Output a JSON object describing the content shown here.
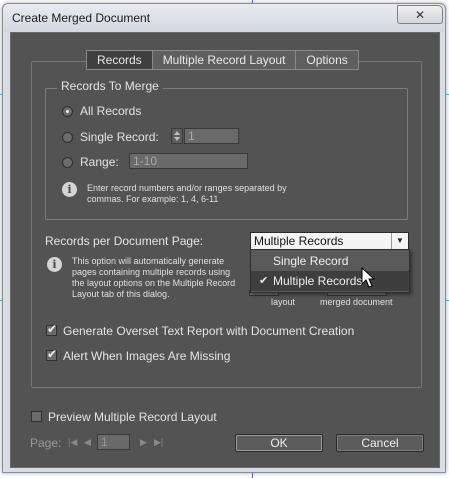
{
  "window": {
    "title": "Create Merged Document",
    "close_glyph": "✕"
  },
  "tabs": [
    {
      "label": "Records",
      "active": true
    },
    {
      "label": "Multiple Record Layout",
      "active": false
    },
    {
      "label": "Options",
      "active": false
    }
  ],
  "records_to_merge": {
    "title": "Records To Merge",
    "options": {
      "all": {
        "label": "All Records",
        "checked": true
      },
      "single": {
        "label": "Single Record:",
        "value": "1",
        "checked": false
      },
      "range": {
        "label": "Range:",
        "value": "1-10",
        "checked": false
      }
    },
    "info": "Enter record numbers and/or ranges separated by commas. For example: 1, 4, 6-11"
  },
  "per_page": {
    "label": "Records per Document Page:",
    "selected": "Multiple Records",
    "options": [
      "Single Record",
      "Multiple Records"
    ],
    "info": "This option will automatically generate pages containing multiple records using the layout options on the Multiple Record Layout tab of this dialog.",
    "partial_label_1": "layout",
    "partial_label_2": "merged document"
  },
  "checks": {
    "overset": {
      "label": "Generate Overset Text Report with Document Creation",
      "checked": true
    },
    "images": {
      "label": "Alert When Images Are Missing",
      "checked": true
    }
  },
  "preview": {
    "label": "Preview Multiple Record Layout",
    "checked": false
  },
  "pager": {
    "label": "Page:",
    "value": "1"
  },
  "buttons": {
    "ok": "OK",
    "cancel": "Cancel"
  },
  "colors": {
    "panel_bg": "#535353",
    "dropdown_bg": "#f4f4f4",
    "selected_item": "#3e3e3e"
  }
}
